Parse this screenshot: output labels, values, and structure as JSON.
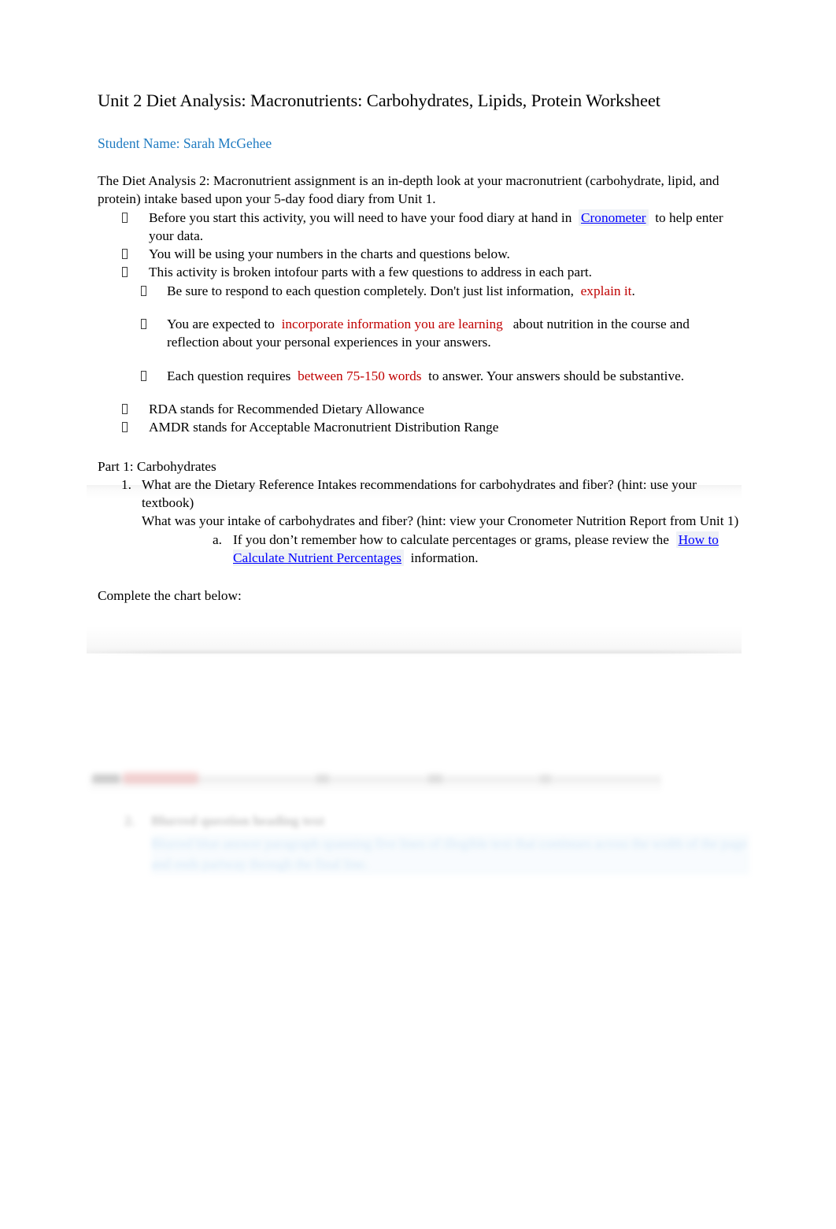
{
  "document": {
    "title": "Unit 2 Diet Analysis: Macronutrients: Carbohydrates, Lipids, Protein Worksheet",
    "student_name_line": "Student Name: Sarah McGehee",
    "intro_paragraph": "The Diet Analysis 2: Macronutrient assignment is an in-depth look at your macronutrient (carbohydrate, lipid, and protein) intake based upon your 5-day food diary from Unit 1."
  },
  "colors": {
    "student_name": "#1F7BC1",
    "emphasis_red": "#C00000",
    "hyperlink_blue": "#0000FF",
    "body_text": "#000000",
    "page_background": "#FFFFFF",
    "faded_answer_blue": "#8CBEE8"
  },
  "bullets": {
    "glyph": "tofu-box-missing-glyph",
    "level1": [
      {
        "before": "Before you start this activity, you will need to have your food diary at hand in",
        "link": "Cronometer",
        "after": "to help enter your data."
      },
      {
        "text": "You will be using your numbers in the charts and questions below."
      },
      {
        "text": "This activity is broken intofour parts  with a few questions to address in each part."
      }
    ],
    "level2": [
      {
        "before": "Be sure to respond to each question completely.    Don't just list information,",
        "red": "explain it",
        "after": "."
      },
      {
        "before": "You are expected to",
        "red": "incorporate information you are learning",
        "after": "about nutrition in the course and reflection about your personal experiences in your answers."
      },
      {
        "before": "Each question requires",
        "red": "between 75-150 words",
        "after": "to answer. Your answers should be substantive."
      }
    ],
    "definitions": [
      "RDA stands for Recommended Dietary Allowance",
      "AMDR stands for Acceptable Macronutrient Distribution Range"
    ]
  },
  "part1": {
    "heading": "Part 1: Carbohydrates",
    "question_number": "1.",
    "question_line_1": "What are the Dietary Reference Intakes  recommendations   for carbohydrates and fiber?   (hint: use your textbook)",
    "question_line_2": "What was your intake  of carbohydrates and fiber?  (hint: view your Cronometer Nutrition Report from Unit 1)",
    "sub_item": {
      "marker": "a.",
      "before": "If you don’t remember how to calculate percentages or grams, please review the",
      "link": "How to Calculate Nutrient Percentages",
      "after": "information."
    },
    "chart_note": "Complete the chart below:"
  },
  "faded_section": {
    "note": "blurred-illegible-content",
    "question_number": "2.",
    "question_heading_placeholder": "Blurred question heading text",
    "answer_placeholder": "Blurred blue answer paragraph spanning five lines of illegible text that continues across the width of the page and ends partway through the final line."
  }
}
